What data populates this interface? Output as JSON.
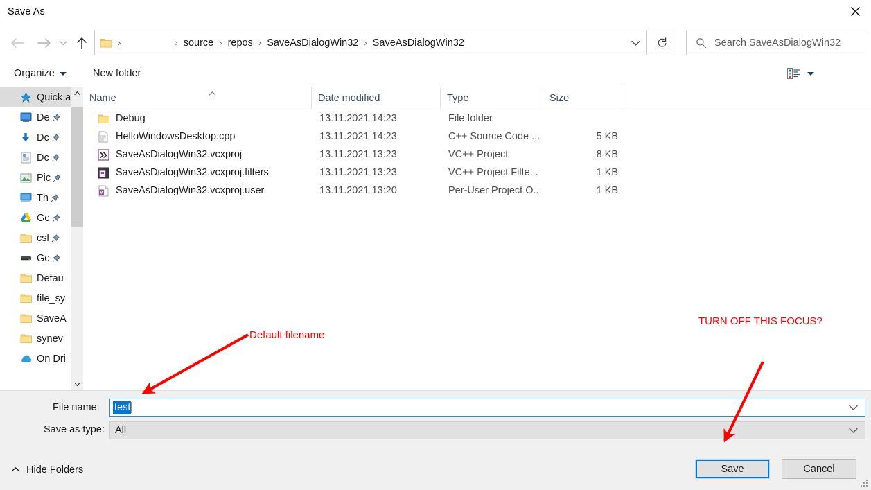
{
  "window": {
    "title": "Save As",
    "close_icon": "close-icon"
  },
  "navigation": {
    "back_icon": "arrow-left-icon",
    "forward_icon": "arrow-right-icon",
    "recent_icon": "chevron-down-icon",
    "up_icon": "arrow-up-icon",
    "refresh_icon": "refresh-icon",
    "address_dropdown_icon": "chevron-down-icon",
    "folder_icon": "folder-icon",
    "breadcrumbs": [
      "source",
      "repos",
      "SaveAsDialogWin32",
      "SaveAsDialogWin32"
    ],
    "separator": "›"
  },
  "search": {
    "icon": "search-icon",
    "placeholder": "Search SaveAsDialogWin32",
    "value": ""
  },
  "command_bar": {
    "organize_label": "Organize",
    "organize_caret_icon": "caret-down-icon",
    "new_folder_label": "New folder",
    "view_icon": "view-list-icon",
    "view_caret_icon": "caret-down-icon",
    "help_icon": "help-circle-icon"
  },
  "sidebar": {
    "scroll_up_icon": "chevron-up-icon",
    "scroll_down_icon": "chevron-down-icon",
    "items": [
      {
        "label": "Quick a",
        "icon": "star-icon",
        "pinned": false,
        "selected": true
      },
      {
        "label": "De",
        "icon": "desktop-icon",
        "pinned": true,
        "selected": false
      },
      {
        "label": "Dc",
        "icon": "download-icon",
        "pinned": true,
        "selected": false
      },
      {
        "label": "Dc",
        "icon": "documents-icon",
        "pinned": true,
        "selected": false
      },
      {
        "label": "Pic",
        "icon": "pictures-icon",
        "pinned": true,
        "selected": false
      },
      {
        "label": "Th",
        "icon": "thispc-icon",
        "pinned": true,
        "selected": false
      },
      {
        "label": "Gc",
        "icon": "google-drive-icon",
        "pinned": true,
        "selected": false
      },
      {
        "label": "csl",
        "icon": "folder-icon",
        "pinned": true,
        "selected": false
      },
      {
        "label": "Gc",
        "icon": "drive-icon",
        "pinned": true,
        "selected": false
      },
      {
        "label": "Defau",
        "icon": "folder-icon",
        "pinned": false,
        "selected": false
      },
      {
        "label": "file_sy",
        "icon": "folder-icon",
        "pinned": false,
        "selected": false
      },
      {
        "label": "SaveA",
        "icon": "folder-icon",
        "pinned": false,
        "selected": false
      },
      {
        "label": "synev",
        "icon": "folder-icon",
        "pinned": false,
        "selected": false
      },
      {
        "label": "On Dri",
        "icon": "onedrive-icon",
        "pinned": false,
        "selected": false
      }
    ]
  },
  "file_list": {
    "columns": [
      {
        "label": "Name",
        "sorted": "asc"
      },
      {
        "label": "Date modified",
        "sorted": ""
      },
      {
        "label": "Type",
        "sorted": ""
      },
      {
        "label": "Size",
        "sorted": ""
      }
    ],
    "sort_caret_icon": "caret-up-icon",
    "rows": [
      {
        "name": "Debug",
        "date": "13.11.2021 14:23",
        "type": "File folder",
        "size": "",
        "icon": "folder-icon"
      },
      {
        "name": "HelloWindowsDesktop.cpp",
        "date": "13.11.2021 14:23",
        "type": "C++ Source Code ...",
        "size": "5 KB",
        "icon": "source-file-icon"
      },
      {
        "name": "SaveAsDialogWin32.vcxproj",
        "date": "13.11.2021 13:23",
        "type": "VC++ Project",
        "size": "8 KB",
        "icon": "vcxproj-icon"
      },
      {
        "name": "SaveAsDialogWin32.vcxproj.filters",
        "date": "13.11.2021 13:23",
        "type": "VC++ Project Filte...",
        "size": "1 KB",
        "icon": "vcxproj-filters-icon"
      },
      {
        "name": "SaveAsDialogWin32.vcxproj.user",
        "date": "13.11.2021 13:20",
        "type": "Per-User Project O...",
        "size": "1 KB",
        "icon": "vcxproj-user-icon"
      }
    ]
  },
  "form": {
    "filename_label": "File name:",
    "filename_value": "test",
    "filename_dropdown_icon": "chevron-down-icon",
    "savetype_label": "Save as type:",
    "savetype_value": "All",
    "savetype_dropdown_icon": "chevron-down-icon"
  },
  "footer": {
    "hide_folders_label": "Hide Folders",
    "hide_folders_icon": "chevron-up-icon",
    "save_label": "Save",
    "cancel_label": "Cancel",
    "resize_grip_icon": "resize-grip-icon"
  },
  "annotations": {
    "filename_note": "Default filename",
    "focus_note": "TURN OFF THIS FOCUS?",
    "color": "#ff0000"
  }
}
